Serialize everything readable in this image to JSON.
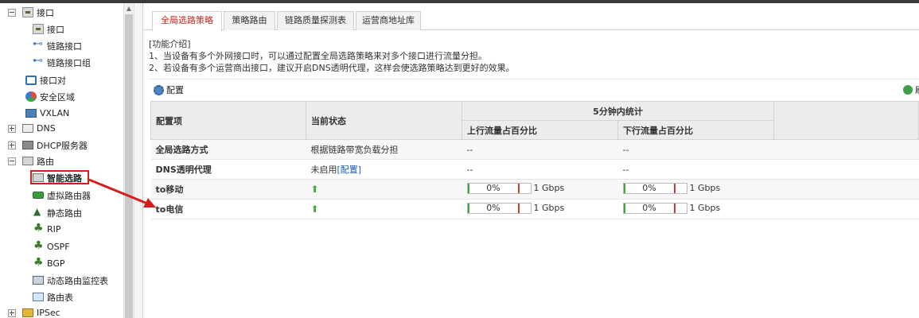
{
  "sidebar": {
    "items": [
      {
        "label": "接口",
        "expander": "minus",
        "icon": "folder-icon"
      },
      {
        "label": "接口",
        "icon": "folder-icon"
      },
      {
        "label": "链路接口",
        "icon": "link-node-icon"
      },
      {
        "label": "链路接口组",
        "icon": "link-group-icon"
      },
      {
        "label": "接口对",
        "icon": "interface-pair-icon"
      },
      {
        "label": "安全区域",
        "icon": "security-zone-icon"
      },
      {
        "label": "VXLAN",
        "icon": "vxlan-icon"
      },
      {
        "label": "DNS",
        "expander": "plus",
        "icon": "dns-icon"
      },
      {
        "label": "DHCP服务器",
        "expander": "plus",
        "icon": "server-icon"
      },
      {
        "label": "路由",
        "expander": "minus",
        "icon": "route-folder-icon"
      },
      {
        "label": "智能选路",
        "icon": "smart-routing-icon",
        "selected": true
      },
      {
        "label": "虚拟路由器",
        "icon": "virtual-router-icon"
      },
      {
        "label": "静态路由",
        "icon": "static-route-icon"
      },
      {
        "label": "RIP",
        "icon": "rip-icon"
      },
      {
        "label": "OSPF",
        "icon": "ospf-icon"
      },
      {
        "label": "BGP",
        "icon": "bgp-icon"
      },
      {
        "label": "动态路由监控表",
        "icon": "route-monitor-icon"
      },
      {
        "label": "路由表",
        "icon": "route-table-icon"
      },
      {
        "label": "IPSec",
        "expander": "plus",
        "icon": "ipsec-icon"
      }
    ]
  },
  "tabs": [
    {
      "label": "全局选路策略",
      "active": true
    },
    {
      "label": "策略路由"
    },
    {
      "label": "链路质量探测表"
    },
    {
      "label": "运营商地址库"
    }
  ],
  "intro": {
    "title": "[功能介绍]",
    "line1": "1、当设备有多个外网接口时，可以通过配置全局选路策略来对多个接口进行流量分担。",
    "line2": "2、若设备有多个运营商出接口，建议开启DNS透明代理，这样会使选路策略达到更好的效果。"
  },
  "toolbar": {
    "config_label": "配置",
    "refresh_label": "刷"
  },
  "table": {
    "headers": {
      "item": "配置项",
      "status": "当前状态",
      "stats": "5分钟内统计",
      "up": "上行流量占百分比",
      "down": "下行流量占百分比"
    },
    "rows": [
      {
        "item": "全局选路方式",
        "status": "根据链路带宽负载分担",
        "up": "--",
        "down": "--"
      },
      {
        "item": "DNS透明代理",
        "status": "未启用",
        "status_link": "[配置]",
        "up": "--",
        "down": "--"
      },
      {
        "item": "to移动",
        "status_icon": "up-arrow-icon",
        "up_pct": "0%",
        "up_rate": 0,
        "up_cap": "1 Gbps",
        "down_pct": "0%",
        "down_rate": 0,
        "down_cap": "1 Gbps"
      },
      {
        "item": "to电信",
        "status_icon": "up-arrow-icon",
        "up_pct": "0%",
        "up_rate": 0,
        "up_cap": "1 Gbps",
        "down_pct": "0%",
        "down_rate": 0,
        "down_cap": "1 Gbps"
      }
    ]
  },
  "colors": {
    "accent_red": "#c8251b",
    "link_blue": "#1d5bb8",
    "ok_green": "#3aaa3a"
  }
}
